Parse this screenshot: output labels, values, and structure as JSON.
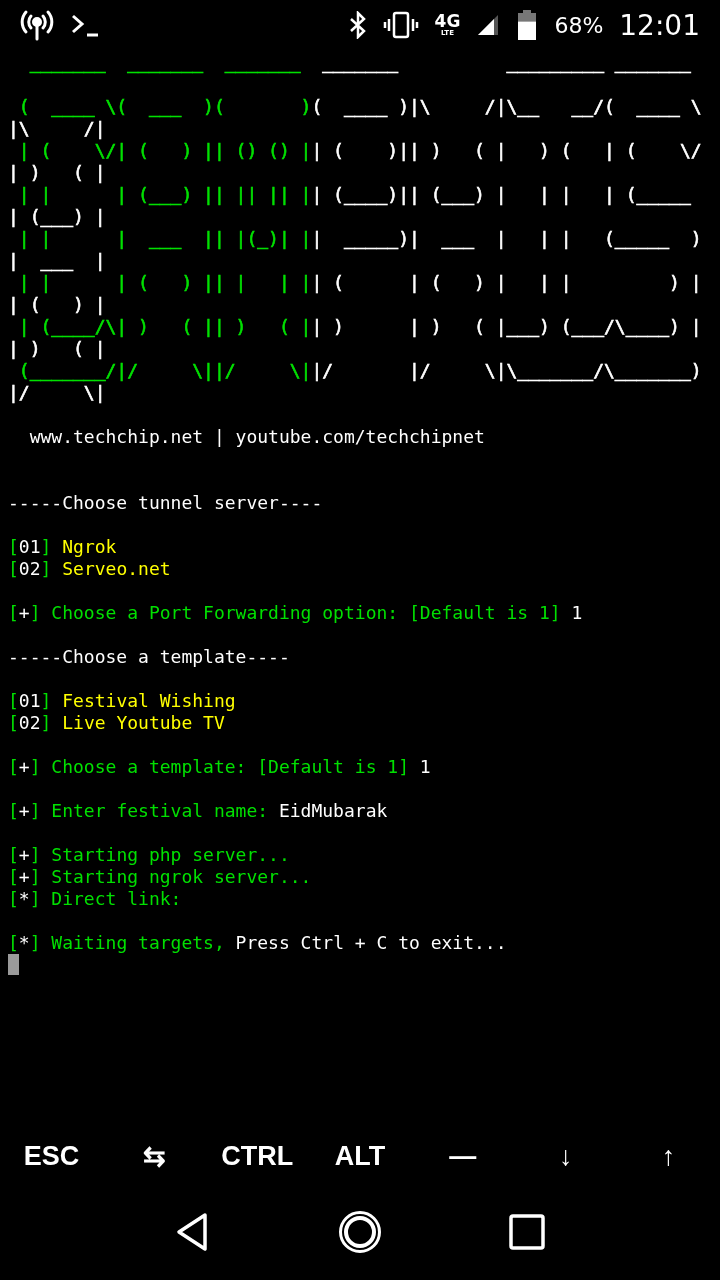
{
  "status_bar": {
    "network": "4G",
    "network_sub": "LTE",
    "battery": "68%",
    "time": "12:01"
  },
  "banner": [
    {
      "kind": "text",
      "segments": [
        {
          "text": "  _______  _______  _______ ",
          "color": "#00e000"
        },
        {
          "text": " _______          _________ _______",
          "color": "#ffffff"
        }
      ]
    },
    {
      "kind": "blank"
    },
    {
      "kind": "text",
      "segments": [
        {
          "text": " (  ____ \\(  ___  )(       )",
          "color": "#00e000"
        },
        {
          "text": "(  ____ )|\\     /|\\__   __/(  ____ \\",
          "color": "#ffffff"
        }
      ]
    },
    {
      "kind": "text",
      "segments": [
        {
          "text": "|\\     /|",
          "color": "#ffffff"
        }
      ]
    },
    {
      "kind": "text",
      "segments": [
        {
          "text": " | (    \\/| (   ) || () () |",
          "color": "#00e000"
        },
        {
          "text": "| (    )|| )   ( |   ) (   | (    \\/",
          "color": "#ffffff"
        }
      ]
    },
    {
      "kind": "text",
      "segments": [
        {
          "text": "| )   ( |",
          "color": "#ffffff"
        }
      ]
    },
    {
      "kind": "text",
      "segments": [
        {
          "text": " | |      | (___) || || || |",
          "color": "#00e000"
        },
        {
          "text": "| (____)|| (___) |   | |   | (_____",
          "color": "#ffffff"
        }
      ]
    },
    {
      "kind": "text",
      "segments": [
        {
          "text": "| (___) |",
          "color": "#ffffff"
        }
      ]
    },
    {
      "kind": "text",
      "segments": [
        {
          "text": " | |      |  ___  || |(_)| |",
          "color": "#00e000"
        },
        {
          "text": "|  _____)|  ___  |   | |   (_____  )",
          "color": "#ffffff"
        }
      ]
    },
    {
      "kind": "text",
      "segments": [
        {
          "text": "|  ___  |",
          "color": "#ffffff"
        }
      ]
    },
    {
      "kind": "text",
      "segments": [
        {
          "text": " | |      | (   ) || |   | |",
          "color": "#00e000"
        },
        {
          "text": "| (      | (   ) |   | |         ) |",
          "color": "#ffffff"
        }
      ]
    },
    {
      "kind": "text",
      "segments": [
        {
          "text": "| (   ) |",
          "color": "#ffffff"
        }
      ]
    },
    {
      "kind": "text",
      "segments": [
        {
          "text": " | (____/\\| )   ( || )   ( |",
          "color": "#00e000"
        },
        {
          "text": "| )      | )   ( |___) (___/\\____) |",
          "color": "#ffffff"
        }
      ]
    },
    {
      "kind": "text",
      "segments": [
        {
          "text": "| )   ( |",
          "color": "#ffffff"
        }
      ]
    },
    {
      "kind": "text",
      "segments": [
        {
          "text": " (_______/|/     \\||/     \\|",
          "color": "#00e000"
        },
        {
          "text": "|/       |/     \\|\\_______/\\_______)",
          "color": "#ffffff"
        }
      ]
    },
    {
      "kind": "text",
      "segments": [
        {
          "text": "|/     \\|",
          "color": "#ffffff"
        }
      ]
    }
  ],
  "output": [
    {
      "kind": "blank"
    },
    {
      "kind": "text",
      "segments": [
        {
          "text": "  www.techchip.net | youtube.com/techchipnet",
          "color": "#ffffff"
        }
      ]
    },
    {
      "kind": "blank"
    },
    {
      "kind": "blank"
    },
    {
      "kind": "text",
      "segments": [
        {
          "text": "-----Choose tunnel server----",
          "color": "#ffffff"
        }
      ]
    },
    {
      "kind": "blank"
    },
    {
      "kind": "text",
      "segments": [
        {
          "text": "[",
          "color": "#00e000"
        },
        {
          "text": "01",
          "color": "#ffffff"
        },
        {
          "text": "] ",
          "color": "#00e000"
        },
        {
          "text": "Ngrok",
          "color": "#ffff00"
        }
      ]
    },
    {
      "kind": "text",
      "segments": [
        {
          "text": "[",
          "color": "#00e000"
        },
        {
          "text": "02",
          "color": "#ffffff"
        },
        {
          "text": "] ",
          "color": "#00e000"
        },
        {
          "text": "Serveo.net",
          "color": "#ffff00"
        }
      ]
    },
    {
      "kind": "blank"
    },
    {
      "kind": "text",
      "segments": [
        {
          "text": "[",
          "color": "#00e000"
        },
        {
          "text": "+",
          "color": "#ffffff"
        },
        {
          "text": "] Choose a Port Forwarding option: [Default is 1] ",
          "color": "#00e000"
        },
        {
          "text": "1",
          "color": "#ffffff"
        }
      ]
    },
    {
      "kind": "blank"
    },
    {
      "kind": "text",
      "segments": [
        {
          "text": "-----Choose a template----",
          "color": "#ffffff"
        }
      ]
    },
    {
      "kind": "blank"
    },
    {
      "kind": "text",
      "segments": [
        {
          "text": "[",
          "color": "#00e000"
        },
        {
          "text": "01",
          "color": "#ffffff"
        },
        {
          "text": "] ",
          "color": "#00e000"
        },
        {
          "text": "Festival Wishing",
          "color": "#ffff00"
        }
      ]
    },
    {
      "kind": "text",
      "segments": [
        {
          "text": "[",
          "color": "#00e000"
        },
        {
          "text": "02",
          "color": "#ffffff"
        },
        {
          "text": "] ",
          "color": "#00e000"
        },
        {
          "text": "Live Youtube TV",
          "color": "#ffff00"
        }
      ]
    },
    {
      "kind": "blank"
    },
    {
      "kind": "text",
      "segments": [
        {
          "text": "[",
          "color": "#00e000"
        },
        {
          "text": "+",
          "color": "#ffffff"
        },
        {
          "text": "] Choose a template: [Default is 1] ",
          "color": "#00e000"
        },
        {
          "text": "1",
          "color": "#ffffff"
        }
      ]
    },
    {
      "kind": "blank"
    },
    {
      "kind": "text",
      "segments": [
        {
          "text": "[",
          "color": "#00e000"
        },
        {
          "text": "+",
          "color": "#ffffff"
        },
        {
          "text": "] Enter festival name: ",
          "color": "#00e000"
        },
        {
          "text": "EidMubarak",
          "color": "#ffffff"
        }
      ]
    },
    {
      "kind": "blank"
    },
    {
      "kind": "text",
      "segments": [
        {
          "text": "[",
          "color": "#00e000"
        },
        {
          "text": "+",
          "color": "#ffffff"
        },
        {
          "text": "] Starting php server...",
          "color": "#00e000"
        }
      ]
    },
    {
      "kind": "text",
      "segments": [
        {
          "text": "[",
          "color": "#00e000"
        },
        {
          "text": "+",
          "color": "#ffffff"
        },
        {
          "text": "] Starting ngrok server...",
          "color": "#00e000"
        }
      ]
    },
    {
      "kind": "text",
      "segments": [
        {
          "text": "[",
          "color": "#00e000"
        },
        {
          "text": "*",
          "color": "#ffffff"
        },
        {
          "text": "] Direct link:",
          "color": "#00e000"
        }
      ]
    },
    {
      "kind": "blank"
    },
    {
      "kind": "text",
      "segments": [
        {
          "text": "[",
          "color": "#00e000"
        },
        {
          "text": "*",
          "color": "#ffffff"
        },
        {
          "text": "] Waiting targets, ",
          "color": "#00e000"
        },
        {
          "text": "Press Ctrl + C to exit...",
          "color": "#ffffff"
        }
      ]
    }
  ],
  "extra_keys": [
    "ESC",
    "⇆",
    "CTRL",
    "ALT",
    "—",
    "↓",
    "↑"
  ]
}
